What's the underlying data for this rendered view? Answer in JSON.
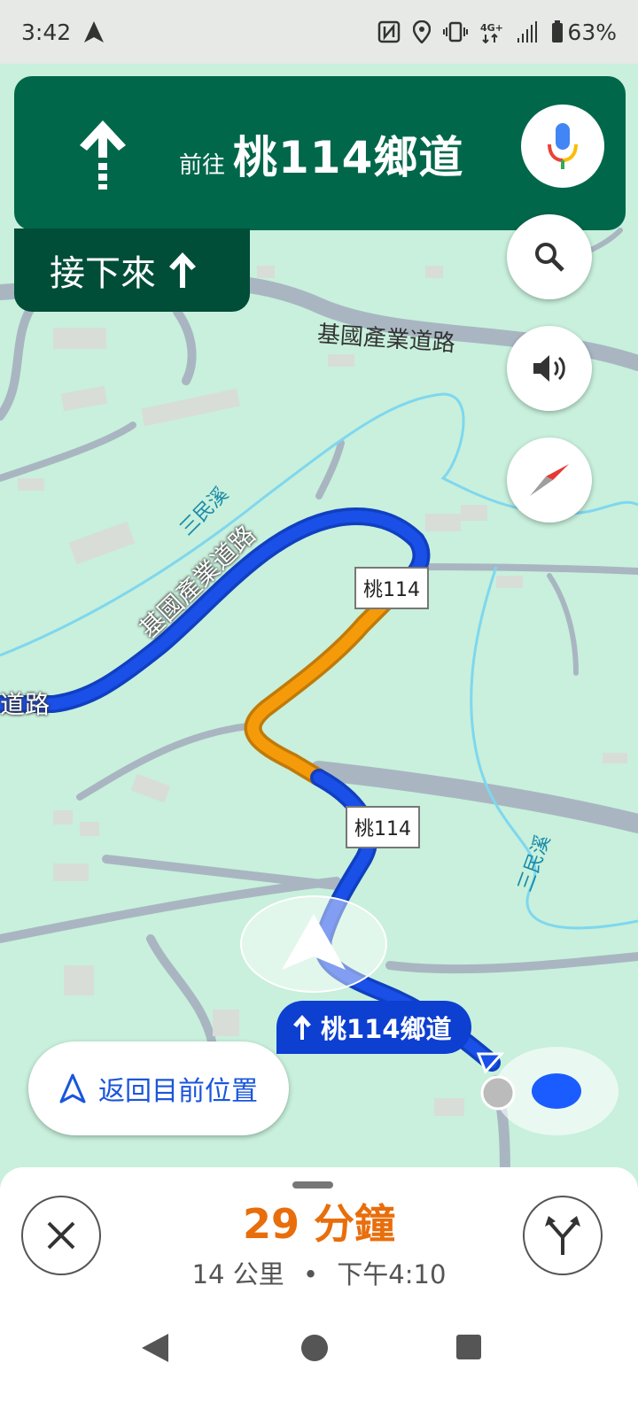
{
  "status_bar": {
    "time": "3:42",
    "battery": "63%",
    "icons": [
      "navigation-icon",
      "nfc-icon",
      "location-icon",
      "vibrate-icon",
      "4g-icon",
      "signal-icon",
      "battery-icon"
    ]
  },
  "banner": {
    "prefix": "前往",
    "road": "桃114鄉道",
    "next_label": "接下來"
  },
  "map_labels": {
    "road_top": "基國產業道路",
    "road_curve": "基國產業道路",
    "road_left": "道路",
    "river_1": "三民溪",
    "river_2": "三民溪",
    "sign_1": "桃114",
    "sign_2": "桃114"
  },
  "current_road_pill": "桃114鄉道",
  "recenter_label": "返回目前位置",
  "trip": {
    "duration": "29 分鐘",
    "distance": "14 公里",
    "separator": "•",
    "arrival": "下午4:10"
  },
  "colors": {
    "banner_bg": "#00674a",
    "next_bg": "#004d38",
    "route_blue": "#1a4fe8",
    "route_orange": "#f59b0a",
    "eta_orange": "#e86e0c",
    "map_bg": "#c8f0dc"
  }
}
